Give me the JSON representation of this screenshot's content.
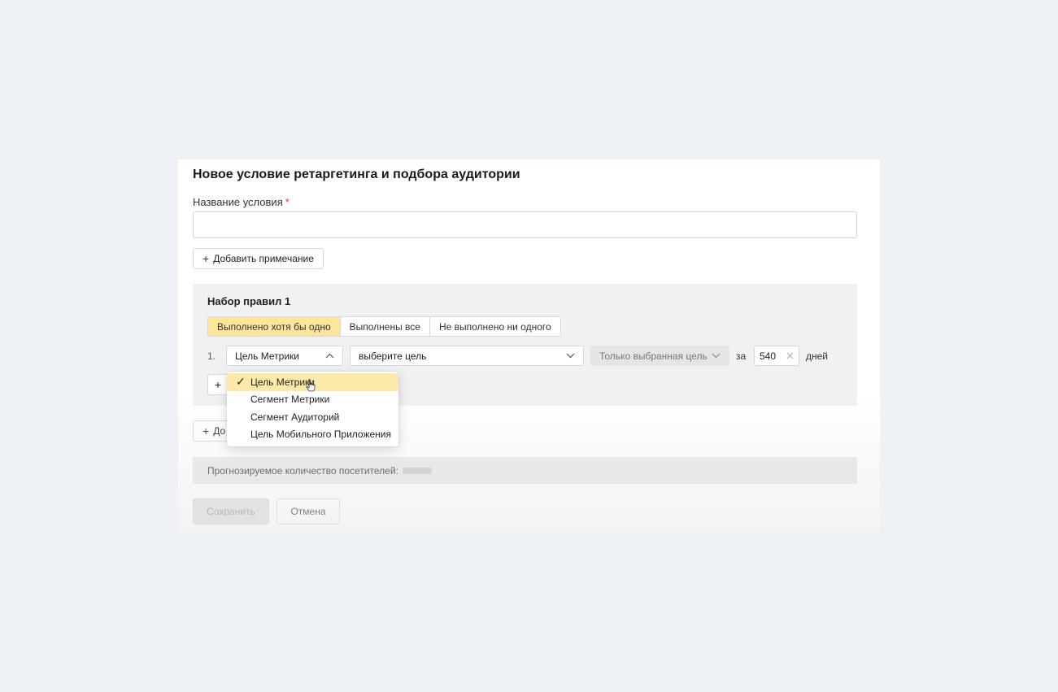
{
  "modal": {
    "title": "Новое условие ретаргетинга и подбора аудитории",
    "name_label": "Название условия",
    "required_mark": "*",
    "name_value": "",
    "add_note_label": "Добавить примечание"
  },
  "ruleset": {
    "title": "Набор правил 1",
    "modes": [
      {
        "label": "Выполнено хотя бы одно",
        "active": true
      },
      {
        "label": "Выполнены все",
        "active": false
      },
      {
        "label": "Не выполнено ни одного",
        "active": false
      }
    ],
    "rule": {
      "number": "1.",
      "type_value": "Цель Метрики",
      "goal_placeholder": "выберите цель",
      "scope_value": "Только выбранная цель",
      "za_label": "за",
      "days_value": "540",
      "days_label": "дней"
    },
    "add_rule_label": "+"
  },
  "add_set_label": "До",
  "forecast": {
    "label": "Прогнозируемое количество посетителей:"
  },
  "footer": {
    "save_label": "Сохранить",
    "cancel_label": "Отмена"
  },
  "dropdown": {
    "options": [
      {
        "label": "Цель Метрики",
        "selected": true
      },
      {
        "label": "Сегмент Метрики",
        "selected": false
      },
      {
        "label": "Сегмент Аудиторий",
        "selected": false
      },
      {
        "label": "Цель Мобильного Приложения",
        "selected": false
      }
    ],
    "check_glyph": "✓"
  },
  "colors": {
    "accent_yellow": "#fde69c",
    "required_red": "#e0433a",
    "page_bg": "#eef1f5"
  }
}
